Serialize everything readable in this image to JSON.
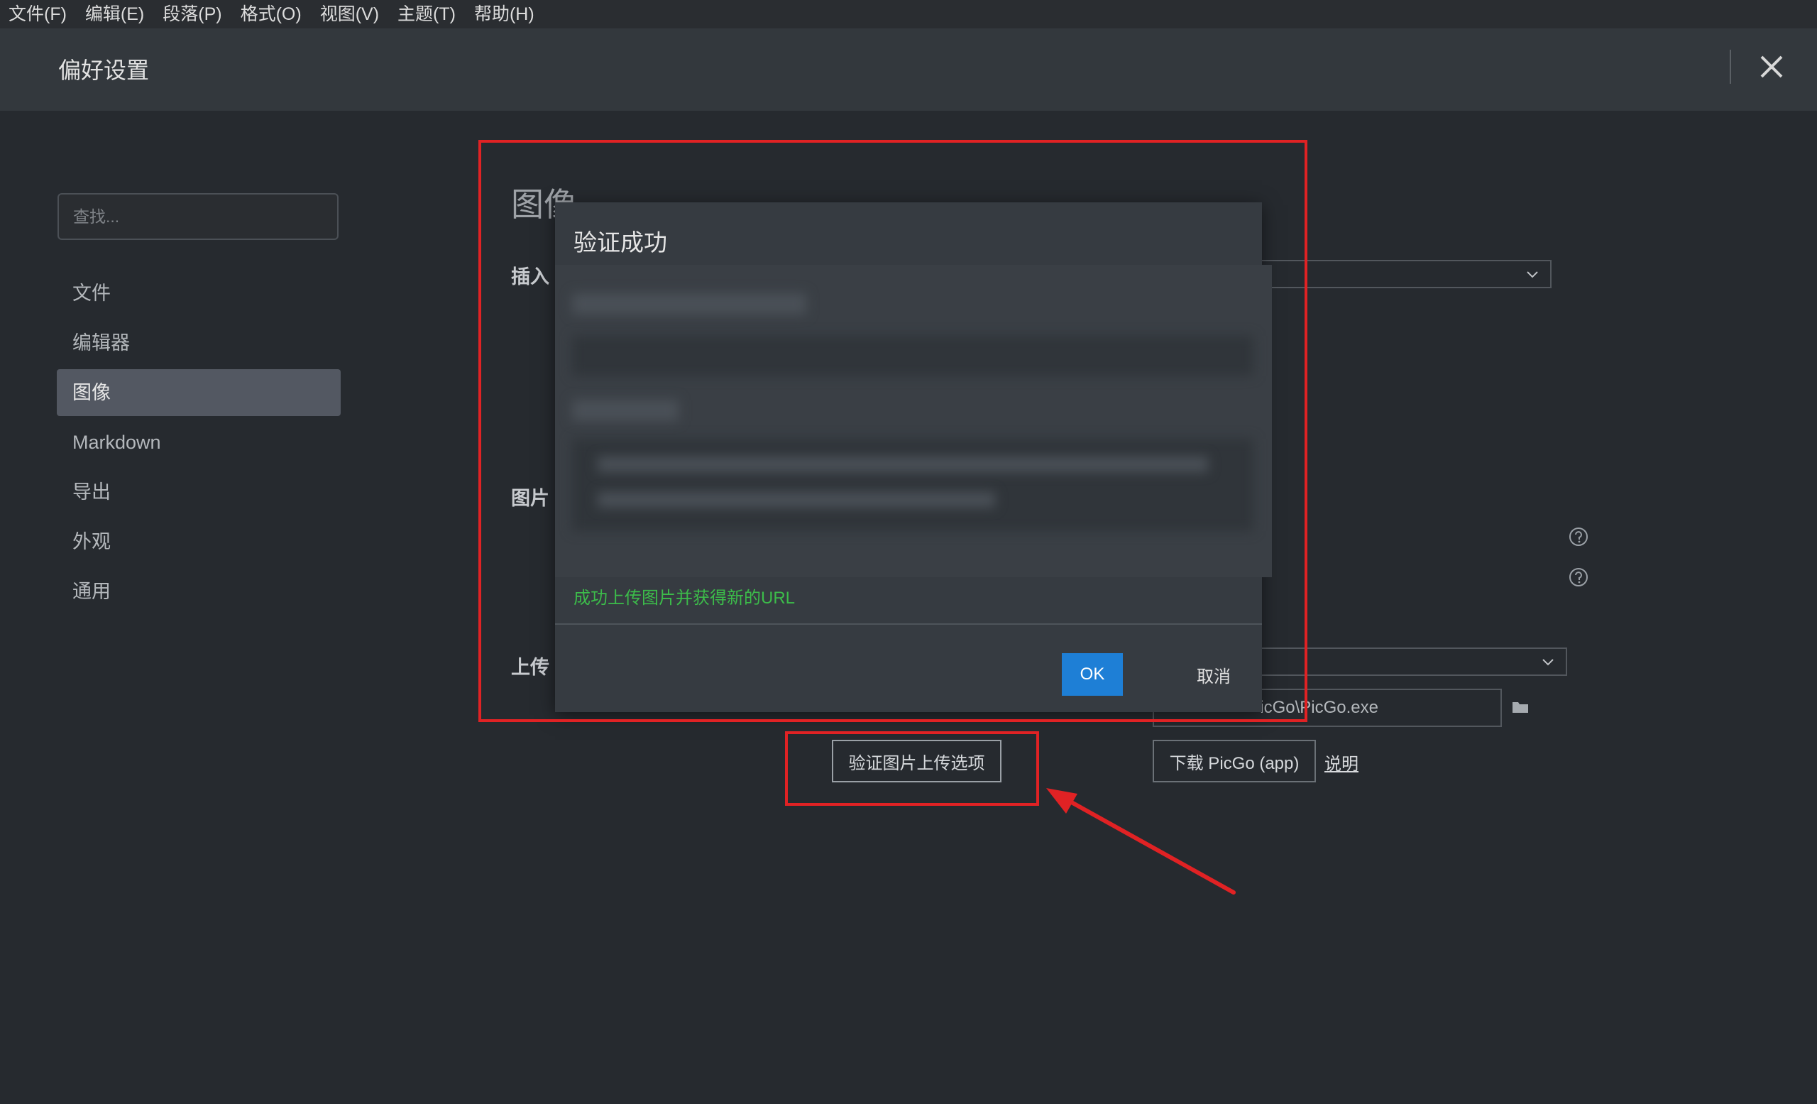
{
  "menubar": {
    "items": [
      "文件(F)",
      "编辑(E)",
      "段落(P)",
      "格式(O)",
      "视图(V)",
      "主题(T)",
      "帮助(H)"
    ]
  },
  "titlebar": {
    "title": "偏好设置",
    "close_icon": "close-icon"
  },
  "sidebar": {
    "search_placeholder": "查找...",
    "items": [
      {
        "label": "文件"
      },
      {
        "label": "编辑器"
      },
      {
        "label": "图像",
        "active": true
      },
      {
        "label": "Markdown"
      },
      {
        "label": "导出"
      },
      {
        "label": "外观"
      },
      {
        "label": "通用"
      }
    ]
  },
  "main": {
    "section_title": "图像",
    "label_insert": "插入",
    "label_image": "图片",
    "label_upload": "上传",
    "picgo_path_value": "icGo\\PicGo.exe",
    "verify_button": "验证图片上传选项",
    "download_button": "下载 PicGo (app)",
    "help_link": "说明"
  },
  "dialog": {
    "title": "验证成功",
    "success_message": "成功上传图片并获得新的URL",
    "ok_label": "OK",
    "cancel_label": "取消"
  },
  "colors": {
    "annotation_red": "#e02224",
    "ok_blue": "#1e7fd6",
    "success_green": "#3cbc4a"
  }
}
